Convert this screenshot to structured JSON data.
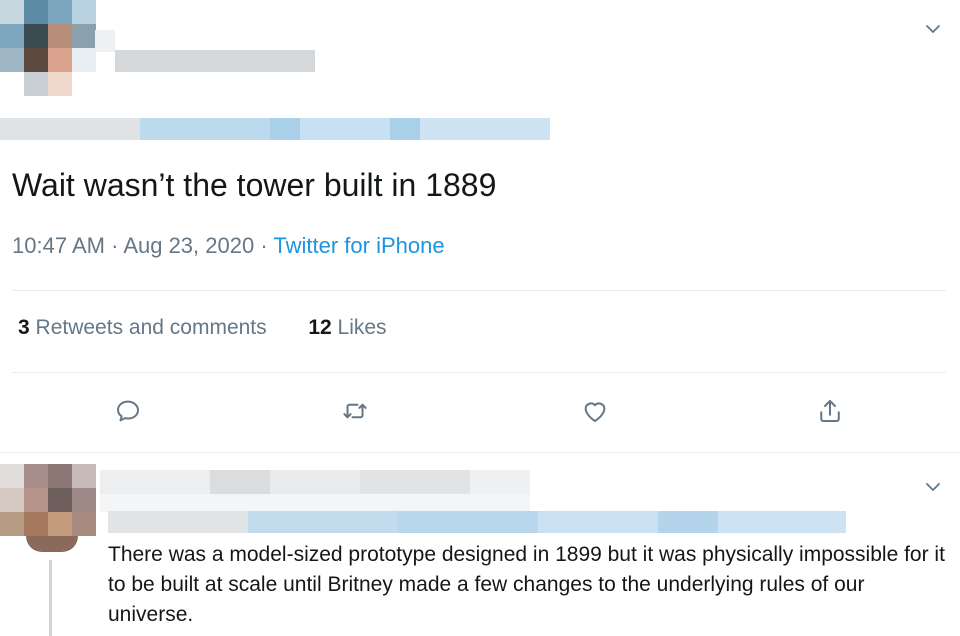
{
  "tweet": {
    "text": "Wait wasn’t the tower built in 1889",
    "time": "10:47 AM",
    "date": "Aug 23, 2020",
    "source": "Twitter for iPhone",
    "retweets_count": "3",
    "retweets_label": "Retweets and comments",
    "likes_count": "12",
    "likes_label": "Likes"
  },
  "reply": {
    "text": "There was a model-sized prototype designed in 1899 but it was physically impossible for it to be built at scale until Britney made a few changes to the underlying rules of our universe."
  },
  "icons": {
    "reply": "speech-bubble-icon",
    "retweet": "retweet-icon",
    "like": "heart-icon",
    "share": "share-icon",
    "menu": "chevron-down-icon"
  },
  "colors": {
    "link": "#1b95e0",
    "secondary_text": "#657786",
    "divider": "#e6ecf0"
  }
}
